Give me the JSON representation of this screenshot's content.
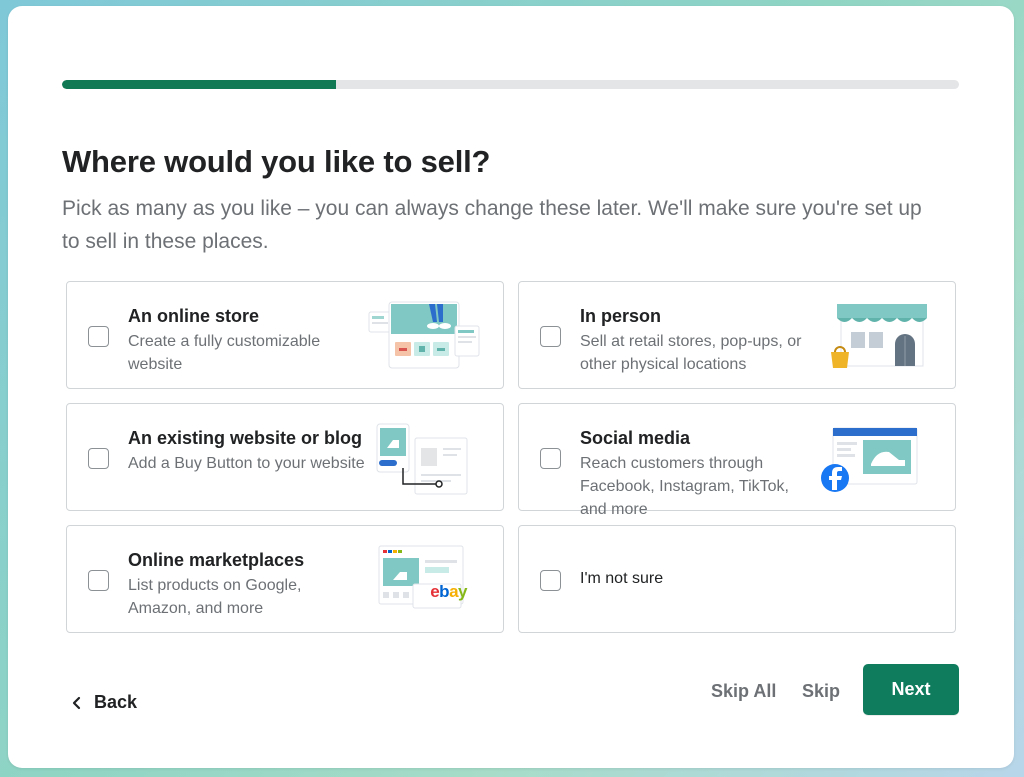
{
  "progress": {
    "fraction": 0.305
  },
  "header": {
    "title": "Where would you like to sell?",
    "subtitle": "Pick as many as you like – you can always change these later. We'll make sure you're set up to sell in these places."
  },
  "options": [
    {
      "title": "An online store",
      "description": "Create a fully customizable website",
      "icon": "online-store-illustration",
      "checked": false
    },
    {
      "title": "In person",
      "description": "Sell at retail stores, pop-ups, or other physical locations",
      "icon": "storefront-illustration",
      "checked": false
    },
    {
      "title": "An existing website or blog",
      "description": "Add a Buy Button to your website",
      "icon": "buy-button-illustration",
      "checked": false
    },
    {
      "title": "Social media",
      "description": "Reach customers through Facebook, Instagram, TikTok, and more",
      "icon": "social-media-illustration",
      "checked": false
    },
    {
      "title": "Online marketplaces",
      "description": "List products on Google, Amazon, and more",
      "icon": "marketplace-illustration",
      "checked": false,
      "badge": "ebay"
    },
    {
      "label": "I'm not sure",
      "checked": false
    }
  ],
  "footer": {
    "back_label": "Back",
    "skip_all_label": "Skip All",
    "skip_label": "Skip",
    "next_label": "Next"
  },
  "colors": {
    "accent": "#117a55",
    "primary_button": "#0f7c5e",
    "progress_track": "#e4e5e7",
    "illustration_teal": "#7fc8c3",
    "facebook_blue": "#1877f2"
  }
}
